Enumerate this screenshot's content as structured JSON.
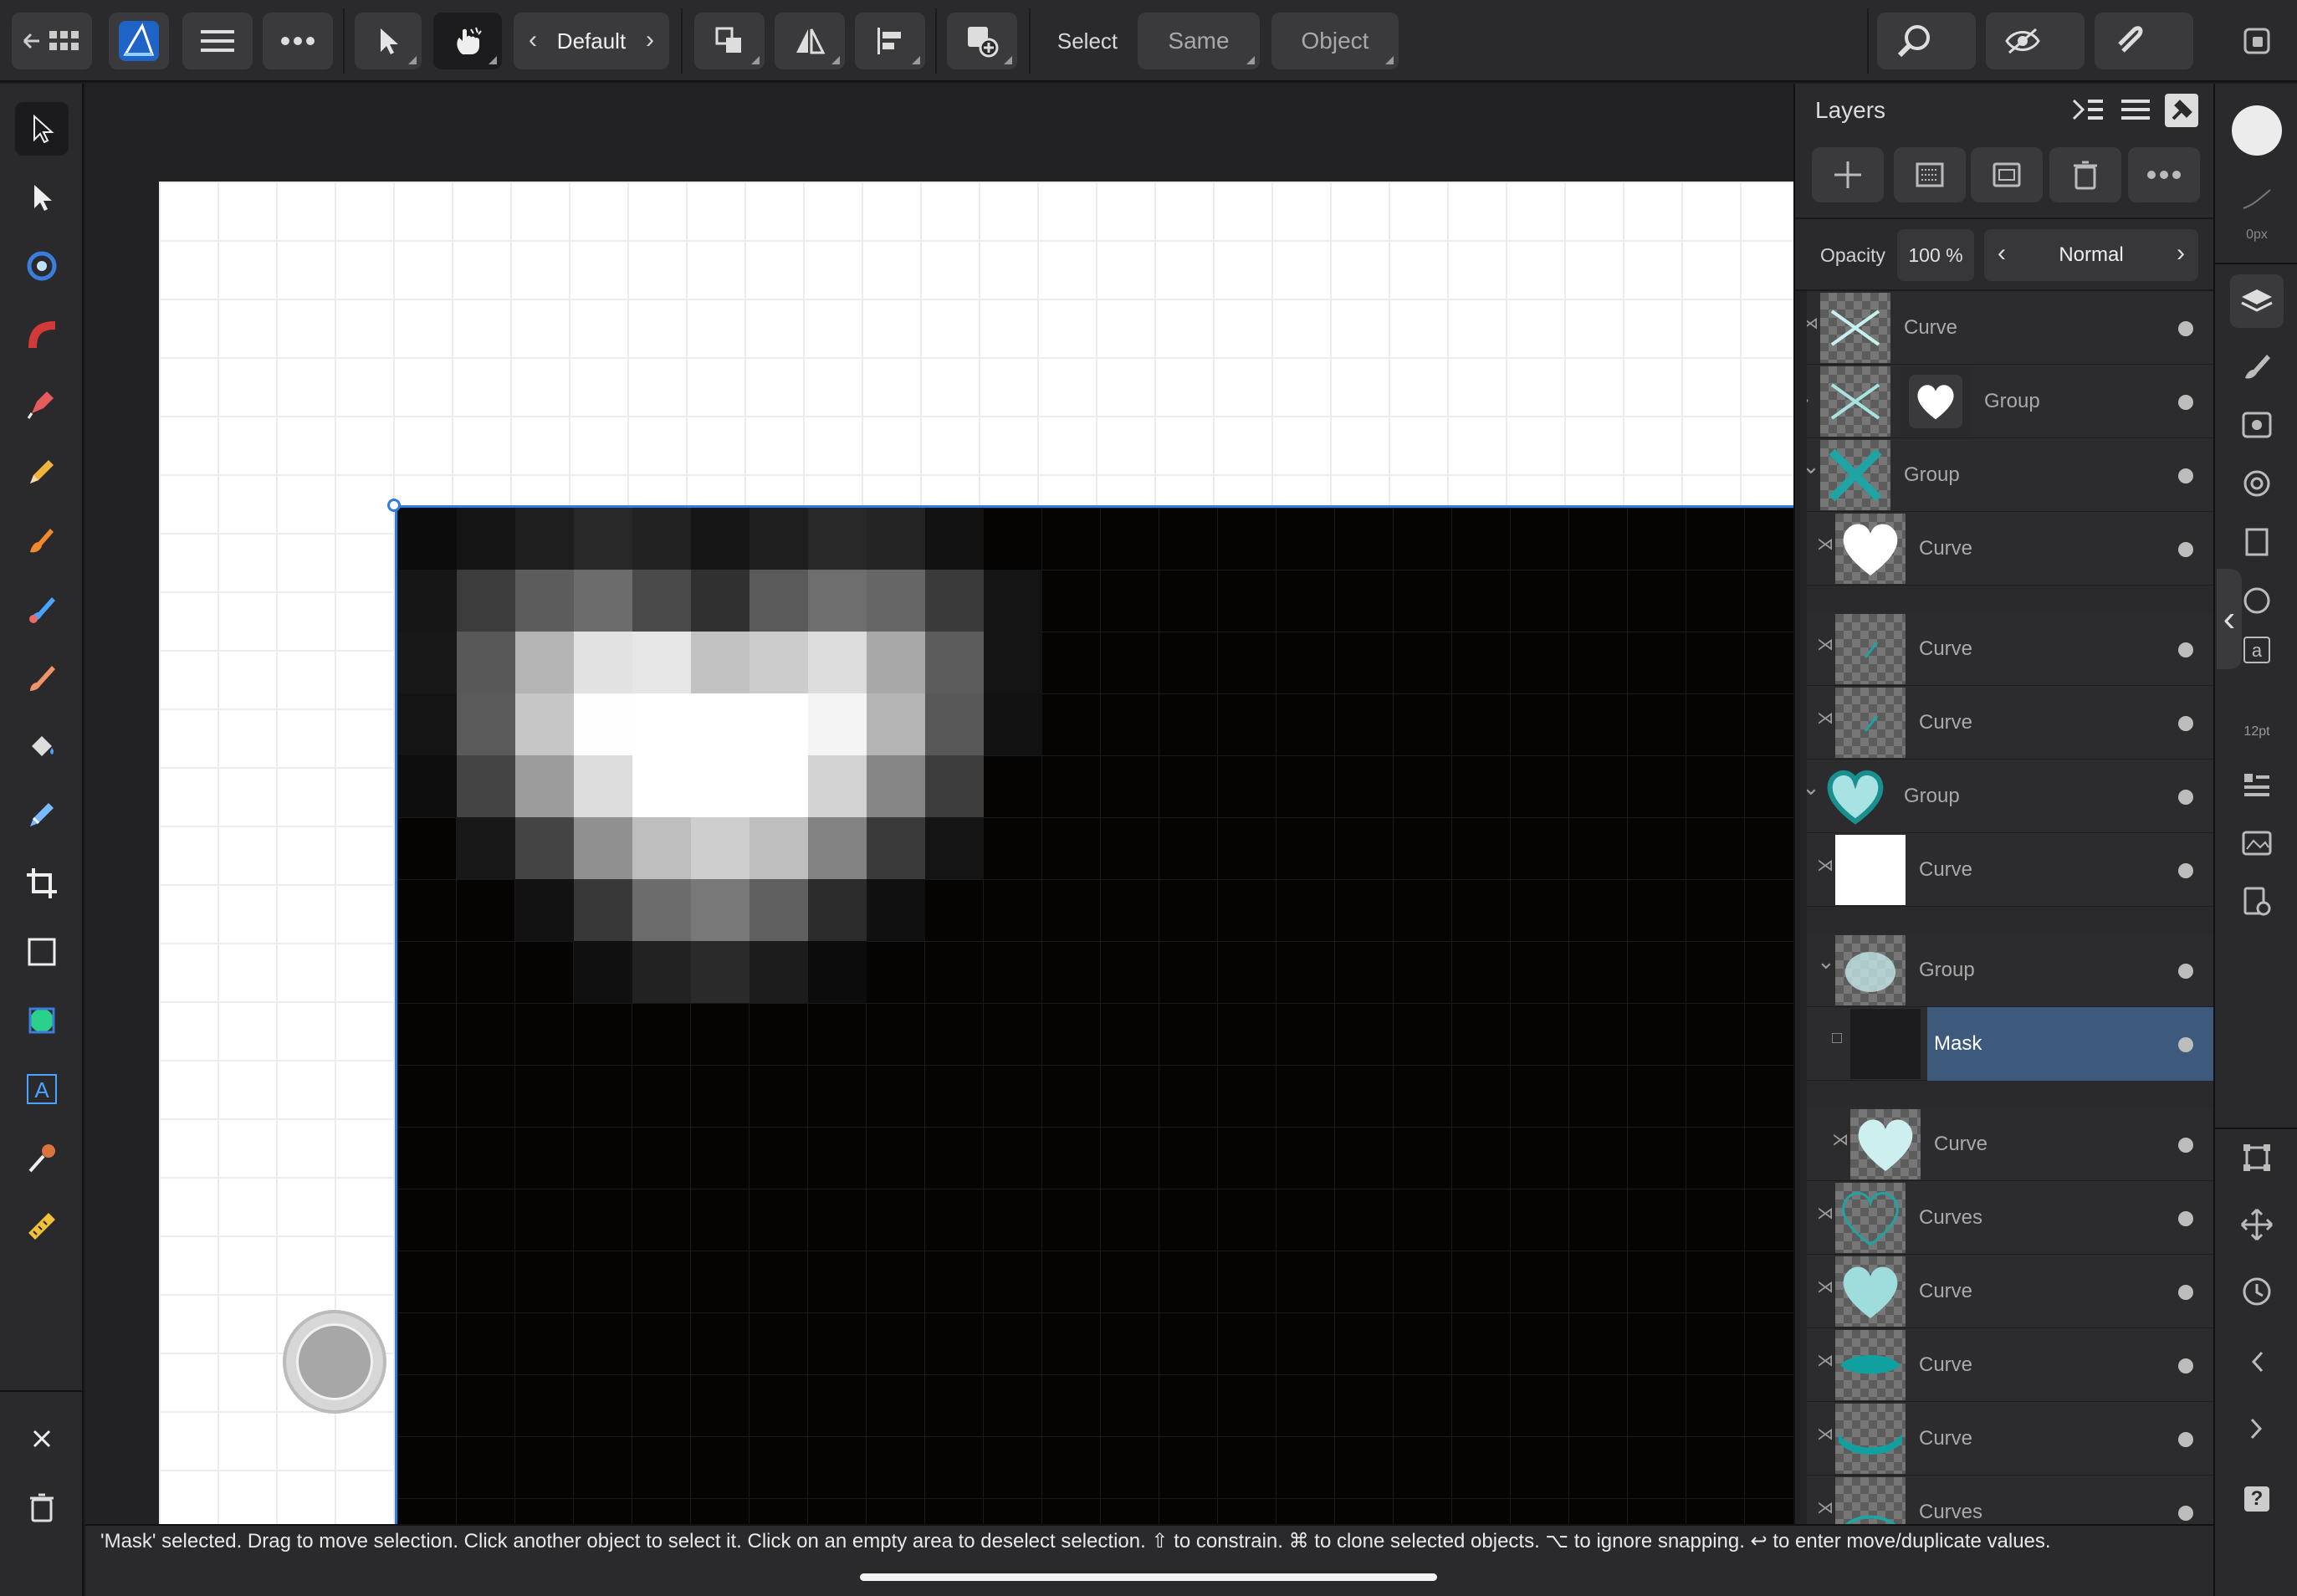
{
  "app": {
    "name": "Affinity Designer"
  },
  "toolbar": {
    "persona_label": "Default",
    "select_label": "Select",
    "same_label": "Same",
    "object_label": "Object"
  },
  "layers_panel": {
    "title": "Layers",
    "opacity_label": "Opacity",
    "opacity_value": "100 %",
    "blend_mode": "Normal",
    "rows": [
      {
        "label": "Curve",
        "thumb": "x-strokes",
        "selected": false
      },
      {
        "label": "Group",
        "thumb": "x-strokes-and-heart",
        "selected": false
      },
      {
        "label": "Group",
        "thumb": "x-teal",
        "selected": false
      },
      {
        "label": "Curve",
        "thumb": "white-heart",
        "selected": false
      },
      {
        "label": "Curve",
        "thumb": "small-stroke",
        "selected": false
      },
      {
        "label": "Curve",
        "thumb": "small-stroke",
        "selected": false
      },
      {
        "label": "Group",
        "thumb": "teal-heart",
        "selected": false
      },
      {
        "label": "Curve",
        "thumb": "white-square",
        "selected": false
      },
      {
        "label": "Group",
        "thumb": "glow",
        "selected": false
      },
      {
        "label": "Mask",
        "thumb": "dark-square",
        "selected": true
      },
      {
        "label": "Curve",
        "thumb": "light-heart",
        "selected": false
      },
      {
        "label": "Curves",
        "thumb": "heart-outline",
        "selected": false
      },
      {
        "label": "Curve",
        "thumb": "teal-heart-solid",
        "selected": false
      },
      {
        "label": "Curve",
        "thumb": "teal-lips",
        "selected": false
      },
      {
        "label": "Curve",
        "thumb": "teal-smile",
        "selected": false
      },
      {
        "label": "Curves",
        "thumb": "teal-arc",
        "selected": false
      }
    ]
  },
  "right_bar": {
    "stroke_width_label": "0px",
    "font_size_label": "12pt"
  },
  "status": {
    "text": "'Mask' selected. Drag to move selection. Click another object to select it. Click on an empty area to deselect selection. ⇧ to constrain. ⌘ to clone selected objects. ⌥ to ignore snapping. ↩ to enter move/duplicate values."
  },
  "colors": {
    "accent": "#2f7de0",
    "selection_row": "#3b5675",
    "teal": "#1fa3a3",
    "light_teal": "#a9e2e2"
  }
}
